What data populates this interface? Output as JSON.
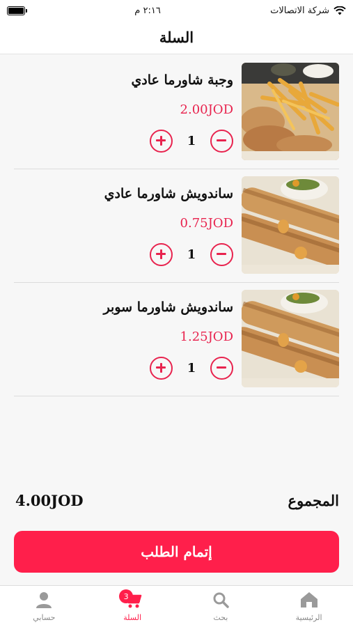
{
  "status_bar": {
    "carrier": "شركة الاتصالات",
    "time": "٢:١٦ م"
  },
  "header": {
    "title": "السلة"
  },
  "cart": {
    "items": [
      {
        "name": "وجبة شاورما عادي",
        "price": "2.00JOD",
        "quantity": "1",
        "image": "shawarma-meal-with-fries"
      },
      {
        "name": "ساندويش شاورما عادي",
        "price": "0.75JOD",
        "quantity": "1",
        "image": "shawarma-sandwich"
      },
      {
        "name": "ساندويش شاورما سوبر",
        "price": "1.25JOD",
        "quantity": "1",
        "image": "shawarma-sandwich"
      }
    ],
    "total_label": "المجموع",
    "total_amount": "4.00JOD"
  },
  "checkout": {
    "label": "إتمام الطلب"
  },
  "tab_bar": {
    "tabs": [
      {
        "label": "حسابي",
        "icon": "person-icon"
      },
      {
        "label": "السلة",
        "icon": "cart-icon",
        "badge": "3",
        "active": true
      },
      {
        "label": "بحث",
        "icon": "search-icon"
      },
      {
        "label": "الرئيسية",
        "icon": "home-icon"
      }
    ]
  },
  "colors": {
    "accent": "#ff1f4b",
    "price": "#e8234e",
    "background": "#f7f7f7"
  }
}
